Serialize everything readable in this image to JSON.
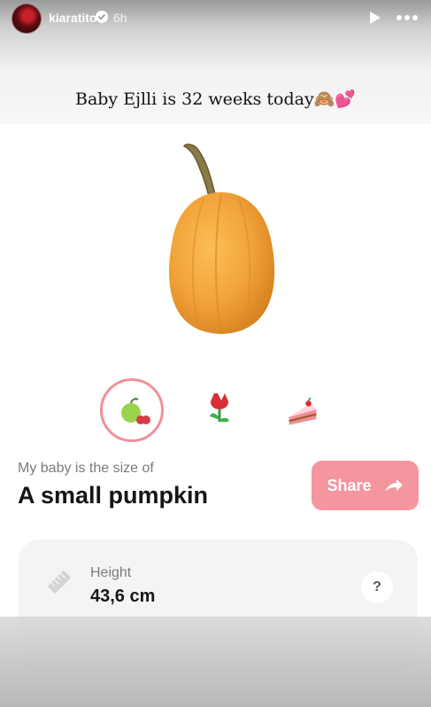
{
  "story": {
    "username": "kiaratito",
    "verified": true,
    "time_ago": "6h",
    "play_icon": "play-icon",
    "more_icon": "more-icon"
  },
  "caption": "Baby Ejlli is 32 weeks today🙈💕",
  "size_choices": [
    {
      "icon": "apple-cherry-icon",
      "selected": true
    },
    {
      "icon": "tulip-icon",
      "selected": false
    },
    {
      "icon": "cake-slice-icon",
      "selected": false
    }
  ],
  "size_info": {
    "subtitle": "My baby is the size of",
    "name": "A small pumpkin"
  },
  "share": {
    "label": "Share",
    "icon": "share-arrow-icon"
  },
  "height_card": {
    "label": "Height",
    "value": "43,6 cm",
    "help_label": "?"
  },
  "colors": {
    "accent": "#f5959d",
    "selected_ring": "#f19099",
    "card_bg": "#f4f4f4",
    "pumpkin": "#f2a23a"
  }
}
